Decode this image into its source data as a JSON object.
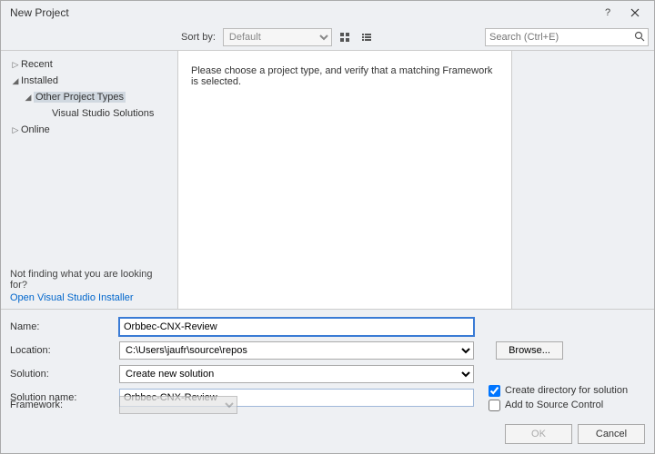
{
  "title": "New Project",
  "toolbar": {
    "sort_label": "Sort by:",
    "sort_value": "Default",
    "search_placeholder": "Search (Ctrl+E)"
  },
  "tree": {
    "recent": "Recent",
    "installed": "Installed",
    "other_types": "Other Project Types",
    "vs_solutions": "Visual Studio Solutions",
    "online": "Online",
    "not_finding": "Not finding what you are looking for?",
    "open_installer": "Open Visual Studio Installer"
  },
  "center": {
    "message": "Please choose a project type, and verify that a matching Framework is selected."
  },
  "form": {
    "name_label": "Name:",
    "name_value": "Orbbec-CNX-Review",
    "location_label": "Location:",
    "location_value": "C:\\Users\\jaufr\\source\\repos",
    "solution_label": "Solution:",
    "solution_value": "Create new solution",
    "solution_name_label": "Solution name:",
    "solution_name_value": "Orbbec-CNX-Review",
    "framework_label": "Framework:",
    "browse": "Browse...",
    "create_dir": "Create directory for solution",
    "add_source": "Add to Source Control",
    "ok": "OK",
    "cancel": "Cancel"
  }
}
